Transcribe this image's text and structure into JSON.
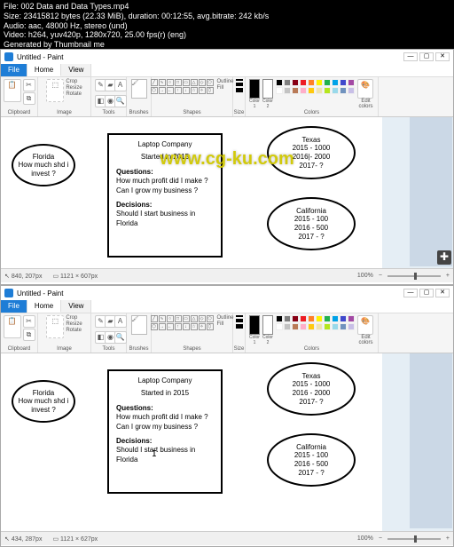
{
  "terminal": {
    "line1": "File: 002 Data and Data Types.mp4",
    "line2": "Size: 23415812 bytes (22.33 MiB), duration: 00:12:55, avg.bitrate: 242 kb/s",
    "line3": "Audio: aac, 48000 Hz, stereo (und)",
    "line4": "Video: h264, yuv420p, 1280x720, 25.00 fps(r) (eng)",
    "line5": "Generated by Thumbnail me"
  },
  "paint": {
    "title": "Untitled - Paint",
    "tab_file": "File",
    "tab_home": "Home",
    "tab_view": "View",
    "grp_clipboard": "Clipboard",
    "grp_image": "Image",
    "grp_tools": "Tools",
    "grp_shapes": "Shapes",
    "grp_colors": "Colors",
    "brushes": "Brushes",
    "paste": "Paste",
    "select": "Select",
    "crop": "Crop",
    "resize": "Resize",
    "rotate": "Rotate",
    "outline": "Outline",
    "fill": "Fill",
    "color1": "Color 1",
    "color2": "Color 2",
    "size_label": "Size",
    "edit_colors": "Edit colors"
  },
  "status": {
    "pos1": "840, 207px",
    "dim1": "1121 × 607px",
    "pos2": "434, 287px",
    "dim2": "1121 × 627px",
    "zoom": "100%"
  },
  "content": {
    "florida_title": "Florida",
    "florida_q": "How much shd i invest ?",
    "box_title": "Laptop Company",
    "box_start": "Started in 2015",
    "box_q_label": "Questions:",
    "box_q1": "How much profit did I make ?",
    "box_q2": "Can I grow my business ?",
    "box_d_label": "Decisions:",
    "box_d1": "Should I start business in Florida",
    "texas_title": "Texas",
    "texas_l1": "2015 - 1000",
    "texas_l2_a": "2016|- 2000",
    "texas_l2_b": "2016 - 2000",
    "texas_l3": "2017- ?",
    "cal_title": "California",
    "cal_l1": "2015 - 100",
    "cal_l2": "2016 - 500",
    "cal_l3": "2017 - ?"
  },
  "watermark": "www.cg-ku.com",
  "palette": [
    "#000000",
    "#7f7f7f",
    "#880015",
    "#ed1c24",
    "#ff7f27",
    "#fff200",
    "#22b14c",
    "#00a2e8",
    "#3f48cc",
    "#a349a4",
    "#ffffff",
    "#c3c3c3",
    "#b97a57",
    "#ffaec9",
    "#ffc90e",
    "#efe4b0",
    "#b5e61d",
    "#99d9ea",
    "#7092be",
    "#c8bfe7"
  ]
}
